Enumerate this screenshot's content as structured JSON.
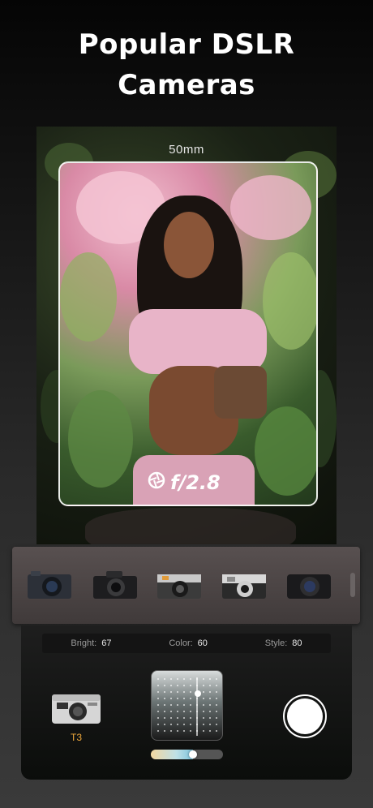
{
  "headline": {
    "line1": "Popular DSLR",
    "line2": "Cameras"
  },
  "viewfinder": {
    "focal_length": "50mm",
    "aperture": "f/2.8"
  },
  "camera_strip": {
    "items": [
      {
        "icon": "camera-mirrorless-black-icon"
      },
      {
        "icon": "camera-dslr-black-icon"
      },
      {
        "icon": "camera-rangefinder-silver-icon"
      },
      {
        "icon": "camera-leica-silver-icon"
      },
      {
        "icon": "camera-compact-black-icon"
      }
    ]
  },
  "params": [
    {
      "label": "Bright:",
      "value": "67"
    },
    {
      "label": "Color:",
      "value": "60"
    },
    {
      "label": "Style:",
      "value": "80"
    }
  ],
  "selected_camera": {
    "label": "T3",
    "icon": "camera-t3-film-icon"
  },
  "color_pad": {
    "icon": "color-grid-pad"
  },
  "tone_slider": {
    "value": 0.58
  },
  "colors": {
    "accent": "#f0a93c",
    "slider_start": "#f3d7a0",
    "slider_end": "#7fc4dd"
  }
}
